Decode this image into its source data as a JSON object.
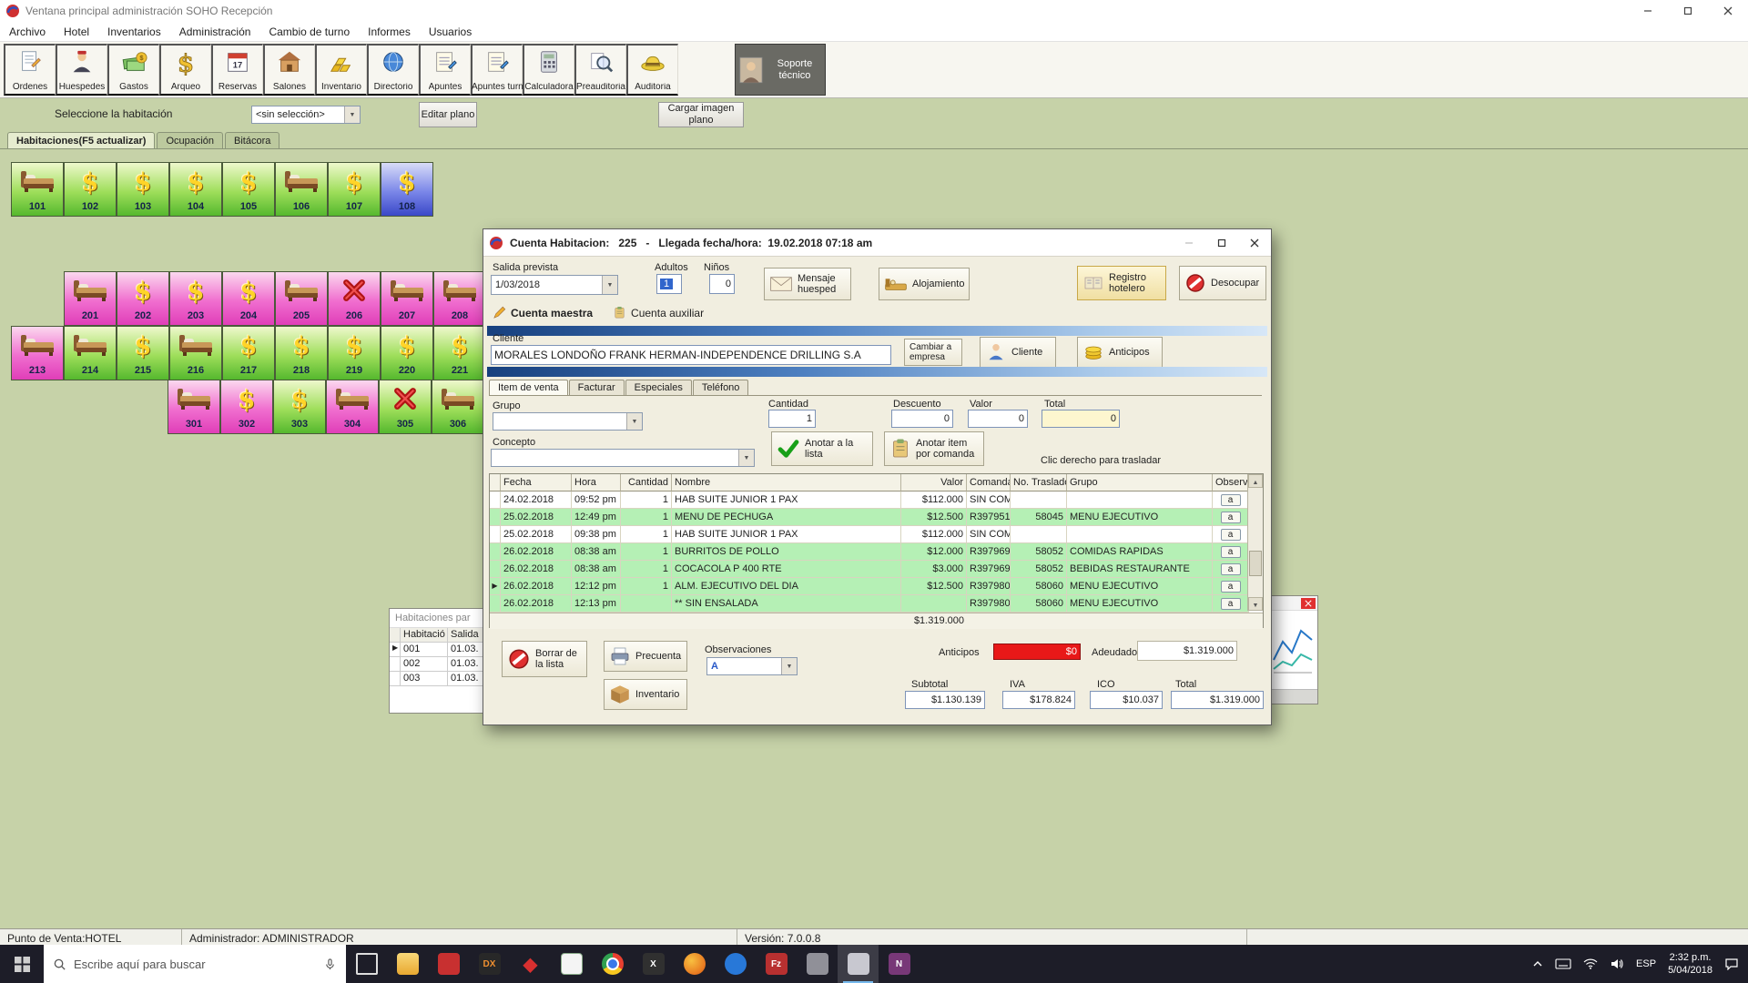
{
  "titlebar": {
    "title": "Ventana principal administración SOHO Recepción"
  },
  "menu": [
    "Archivo",
    "Hotel",
    "Inventarios",
    "Administración",
    "Cambio de turno",
    "Informes",
    "Usuarios"
  ],
  "toolbar": [
    {
      "label": "Ordenes",
      "icon": "sym-page"
    },
    {
      "label": "Huespedes",
      "icon": "sym-guest"
    },
    {
      "label": "Gastos",
      "icon": "sym-cash"
    },
    {
      "label": "Arqueo",
      "icon": "sym-dollar"
    },
    {
      "label": "Reservas",
      "icon": "sym-cal"
    },
    {
      "label": "Salones",
      "icon": "sym-build"
    },
    {
      "label": "Inventario",
      "icon": "sym-gold"
    },
    {
      "label": "Directorio",
      "icon": "sym-globe"
    },
    {
      "label": "Apuntes",
      "icon": "sym-note"
    },
    {
      "label": "Apuntes turno",
      "icon": "sym-note"
    },
    {
      "label": "Calculadora",
      "icon": "sym-calcu"
    },
    {
      "label": "Preauditoria",
      "icon": "sym-mag"
    },
    {
      "label": "Auditoria",
      "icon": "sym-hat"
    }
  ],
  "support_button": {
    "label": "Soporte técnico"
  },
  "room_select": {
    "label": "Seleccione la habitación",
    "value": "<sin selección>",
    "edit_btn": "Editar plano",
    "load_btn": "Cargar imagen plano"
  },
  "main_tabs": [
    {
      "label": "Habitaciones(F5 actualizar)",
      "state": "active"
    },
    {
      "label": "Ocupación",
      "state": ""
    },
    {
      "label": "Bitácora",
      "state": ""
    }
  ],
  "rooms": {
    "row1": [
      {
        "number": "101",
        "state": "green bed"
      },
      {
        "number": "102",
        "state": "green dollar"
      },
      {
        "number": "103",
        "state": "green dollar"
      },
      {
        "number": "104",
        "state": "green dollar"
      },
      {
        "number": "105",
        "state": "green dollar"
      },
      {
        "number": "106",
        "state": "green bed"
      },
      {
        "number": "107",
        "state": "green dollar"
      },
      {
        "number": "108",
        "state": "blue dollar"
      }
    ],
    "row2": [
      {
        "number": "201",
        "state": "pink bed"
      },
      {
        "number": "202",
        "state": "pink dollar"
      },
      {
        "number": "203",
        "state": "pink dollar"
      },
      {
        "number": "204",
        "state": "pink dollar"
      },
      {
        "number": "205",
        "state": "pink bed"
      },
      {
        "number": "206",
        "state": "pink x"
      },
      {
        "number": "207",
        "state": "pink bed"
      },
      {
        "number": "208",
        "state": "pink bed"
      }
    ],
    "row3": [
      {
        "number": "213",
        "state": "pink bed"
      },
      {
        "number": "214",
        "state": "green bed"
      },
      {
        "number": "215",
        "state": "green dollar"
      },
      {
        "number": "216",
        "state": "green bed"
      },
      {
        "number": "217",
        "state": "green dollar"
      },
      {
        "number": "218",
        "state": "green dollar"
      },
      {
        "number": "219",
        "state": "green dollar"
      },
      {
        "number": "220",
        "state": "green dollar"
      },
      {
        "number": "221",
        "state": "green dollar"
      }
    ],
    "row4": [
      {
        "number": "301",
        "state": "pink bed"
      },
      {
        "number": "302",
        "state": "pink dollar"
      },
      {
        "number": "303",
        "state": "green dollar"
      },
      {
        "number": "304",
        "state": "pink bed"
      },
      {
        "number": "305",
        "state": "green x"
      },
      {
        "number": "306",
        "state": "green bed"
      }
    ]
  },
  "back_window": {
    "title": "Habitaciones par",
    "col1": "Habitació",
    "col2": "Salida",
    "rows": [
      {
        "marker": "▶",
        "hab": "001",
        "salida": "01.03."
      },
      {
        "marker": "",
        "hab": "002",
        "salida": "01.03."
      },
      {
        "marker": "",
        "hab": "003",
        "salida": "01.03."
      }
    ]
  },
  "dialog": {
    "title": "Cuenta Habitacion:   225   -   Llegada fecha/hora:  19.02.2018 07:18 am",
    "salida": {
      "label": "Salida prevista",
      "value": "1/03/2018"
    },
    "adultos": {
      "label": "Adultos",
      "value": "1"
    },
    "ninos": {
      "label": "Niños",
      "value": "0"
    },
    "buttons": {
      "mensaje": "Mensaje huesped",
      "alojamiento": "Alojamiento",
      "registro": "Registro hotelero",
      "desocupar": "Desocupar",
      "cambiar": "Cambiar a empresa",
      "cliente": "Cliente",
      "anticipos": "Anticipos",
      "anotar_lista": "Anotar a la lista",
      "anotar_comanda": "Anotar item por comanda",
      "borrar": "Borrar de la lista",
      "precuenta": "Precuenta",
      "inventario": "Inventario"
    },
    "account_tabs": [
      {
        "label": "Cuenta maestra",
        "state": "active",
        "icon": "sym-pencil"
      },
      {
        "label": "Cuenta auxiliar",
        "state": "",
        "icon": "sym-clip"
      }
    ],
    "cliente": {
      "label": "Cliente",
      "value": "MORALES LONDOÑO FRANK HERMAN-INDEPENDENCE DRILLING S.A"
    },
    "sale_tabs": [
      {
        "label": "Item de venta",
        "state": "active"
      },
      {
        "label": "Facturar",
        "state": ""
      },
      {
        "label": "Especiales",
        "state": ""
      },
      {
        "label": "Teléfono",
        "state": ""
      }
    ],
    "grupo_label": "Grupo",
    "concepto_label": "Concepto",
    "cantidad": {
      "label": "Cantidad",
      "value": "1"
    },
    "descuento": {
      "label": "Descuento",
      "value": "0"
    },
    "valor": {
      "label": "Valor",
      "value": "0"
    },
    "total": {
      "label": "Total",
      "value": "0"
    },
    "traslado_hint": "Clic derecho para trasladar",
    "table": {
      "headers": [
        {
          "label": "",
          "key": "gut"
        },
        {
          "label": "Fecha",
          "key": "fecha"
        },
        {
          "label": "Hora",
          "key": "hora"
        },
        {
          "label": "Cantidad",
          "key": "cant"
        },
        {
          "label": "Nombre",
          "key": "nombre"
        },
        {
          "label": "Valor",
          "key": "valor"
        },
        {
          "label": "Comanda",
          "key": "comanda"
        },
        {
          "label": "No. Traslado",
          "key": "traslado"
        },
        {
          "label": "Grupo",
          "key": "grupo"
        },
        {
          "label": "Observacion",
          "key": "obs"
        }
      ],
      "rows": [
        {
          "marker": "",
          "fecha": "24.02.2018",
          "hora": "09:52 pm",
          "cantidad": "1",
          "nombre": "HAB SUITE JUNIOR 1 PAX",
          "valor": "$112.000",
          "comanda": "SIN COM",
          "traslado": "",
          "grupo": "",
          "obs": "a",
          "state": "plain"
        },
        {
          "marker": "",
          "fecha": "25.02.2018",
          "hora": "12:49 pm",
          "cantidad": "1",
          "nombre": "MENU DE PECHUGA",
          "valor": "$12.500",
          "comanda": "R397951",
          "traslado": "58045",
          "grupo": "MENU EJECUTIVO",
          "obs": "a",
          "state": "green"
        },
        {
          "marker": "",
          "fecha": "25.02.2018",
          "hora": "09:38 pm",
          "cantidad": "1",
          "nombre": "HAB SUITE JUNIOR 1 PAX",
          "valor": "$112.000",
          "comanda": "SIN COM",
          "traslado": "",
          "grupo": "",
          "obs": "a",
          "state": "plain"
        },
        {
          "marker": "",
          "fecha": "26.02.2018",
          "hora": "08:38 am",
          "cantidad": "1",
          "nombre": "BURRITOS DE POLLO",
          "valor": "$12.000",
          "comanda": "R397969",
          "traslado": "58052",
          "grupo": "COMIDAS RAPIDAS",
          "obs": "a",
          "state": "green"
        },
        {
          "marker": "",
          "fecha": "26.02.2018",
          "hora": "08:38 am",
          "cantidad": "1",
          "nombre": "COCACOLA P 400 RTE",
          "valor": "$3.000",
          "comanda": "R397969",
          "traslado": "58052",
          "grupo": "BEBIDAS RESTAURANTE",
          "obs": "a",
          "state": "green"
        },
        {
          "marker": "▶",
          "fecha": "26.02.2018",
          "hora": "12:12 pm",
          "cantidad": "1",
          "nombre": "ALM. EJECUTIVO DEL DIA",
          "valor": "$12.500",
          "comanda": "R397980",
          "traslado": "58060",
          "grupo": "MENU EJECUTIVO",
          "obs": "a",
          "state": "green"
        },
        {
          "marker": "",
          "fecha": "26.02.2018",
          "hora": "12:13 pm",
          "cantidad": "",
          "nombre": "** SIN ENSALADA",
          "valor": "",
          "comanda": "R397980",
          "traslado": "58060",
          "grupo": "MENU EJECUTIVO",
          "obs": "a",
          "state": "green"
        }
      ],
      "total_footer": "$1.319.000"
    },
    "observaciones_label": "Observaciones",
    "observaciones_icon": "A",
    "anticipos_field": {
      "label": "Anticipos",
      "value": "$0"
    },
    "adeudado": {
      "label": "Adeudado",
      "value": "$1.319.000"
    },
    "totals": {
      "subtotal_label": "Subtotal",
      "subtotal": "$1.130.139",
      "iva_label": "IVA",
      "iva": "$178.824",
      "ico_label": "ICO",
      "ico": "$10.037",
      "total_label": "Total",
      "total": "$1.319.000"
    }
  },
  "statusbar": {
    "pos": "Punto de Venta:HOTEL",
    "admin": "Administrador: ADMINISTRADOR",
    "version": "Versión: 7.0.0.8"
  },
  "taskbar": {
    "search_placeholder": "Escribe aquí para buscar",
    "apps": [
      {
        "name": "task-view",
        "cls": "ic-taskview",
        "glyph": ""
      },
      {
        "name": "file-explorer",
        "cls": "ic-folder",
        "glyph": ""
      },
      {
        "name": "app-red",
        "cls": "ic-red",
        "glyph": ""
      },
      {
        "name": "app-dx",
        "cls": "ic-dx",
        "glyph": "DX"
      },
      {
        "name": "app-diamond",
        "cls": "ic-diamond",
        "glyph": "◆"
      },
      {
        "name": "app-grid",
        "cls": "ic-grid",
        "glyph": ""
      },
      {
        "name": "browser-chrome",
        "cls": "ic-chrome",
        "glyph": ""
      },
      {
        "name": "app-x",
        "cls": "ic-xapp",
        "glyph": "X"
      },
      {
        "name": "browser-firefox",
        "cls": "ic-firefox",
        "glyph": ""
      },
      {
        "name": "app-blue",
        "cls": "ic-blue",
        "glyph": ""
      },
      {
        "name": "filezilla",
        "cls": "ic-fz",
        "glyph": "Fz"
      },
      {
        "name": "app-gray",
        "cls": "ic-gray",
        "glyph": ""
      },
      {
        "name": "soho-app",
        "cls": "ic-soho active",
        "glyph": ""
      },
      {
        "name": "notes-app",
        "cls": "ic-notes",
        "glyph": "N"
      }
    ],
    "tray": {
      "lang": "ESP",
      "time": "2:32 p.m.",
      "date": "5/04/2018"
    }
  }
}
